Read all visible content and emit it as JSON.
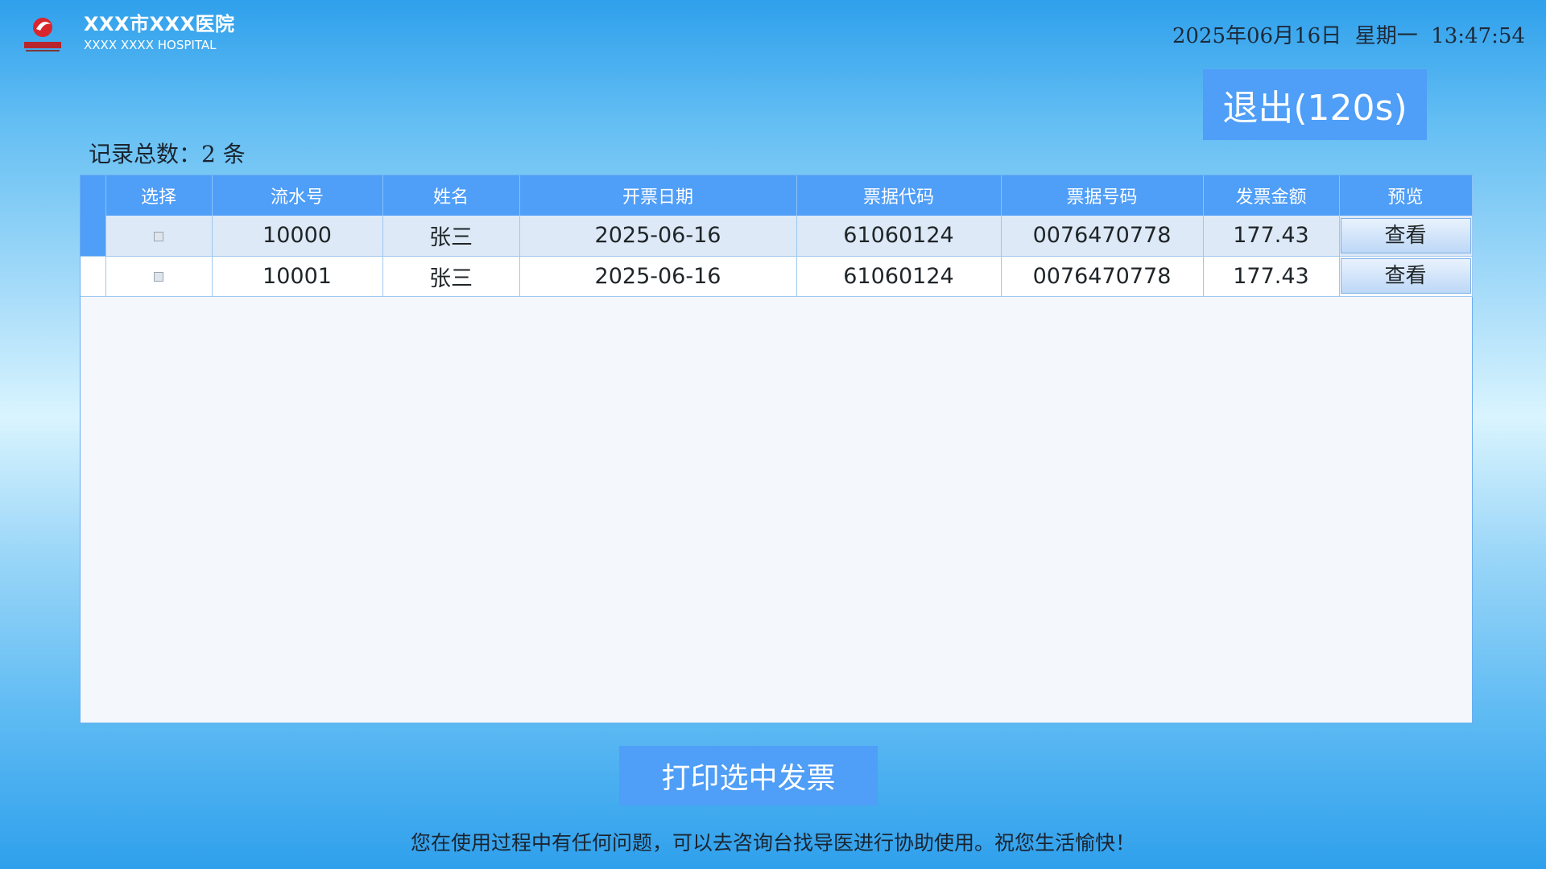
{
  "header": {
    "hospital_name": "XXX市XXX医院",
    "hospital_name_en": "XXXX XXXX HOSPITAL",
    "datetime": "2025年06月16日  星期一  13:47:54"
  },
  "exit_button": {
    "label": "退出(120s)"
  },
  "record_count": "记录总数：2 条",
  "table": {
    "columns": [
      "选择",
      "流水号",
      "姓名",
      "开票日期",
      "票据代码",
      "票据号码",
      "发票金额",
      "预览"
    ],
    "rows": [
      {
        "serial": "10000",
        "name": "张三",
        "date": "2025-06-16",
        "code": "61060124",
        "number": "0076470778",
        "amount": "177.43",
        "view_label": "查看"
      },
      {
        "serial": "10001",
        "name": "张三",
        "date": "2025-06-16",
        "code": "61060124",
        "number": "0076470778",
        "amount": "177.43",
        "view_label": "查看"
      }
    ]
  },
  "print_button": {
    "label": "打印选中发票"
  },
  "footer_note": "您在使用过程中有任何问题，可以去咨询台找导医进行协助使用。祝您生活愉快！",
  "colors": {
    "accent": "#4f9ef7",
    "grid_background": "#f4f8fd",
    "selected_row": "#dde9f7"
  }
}
